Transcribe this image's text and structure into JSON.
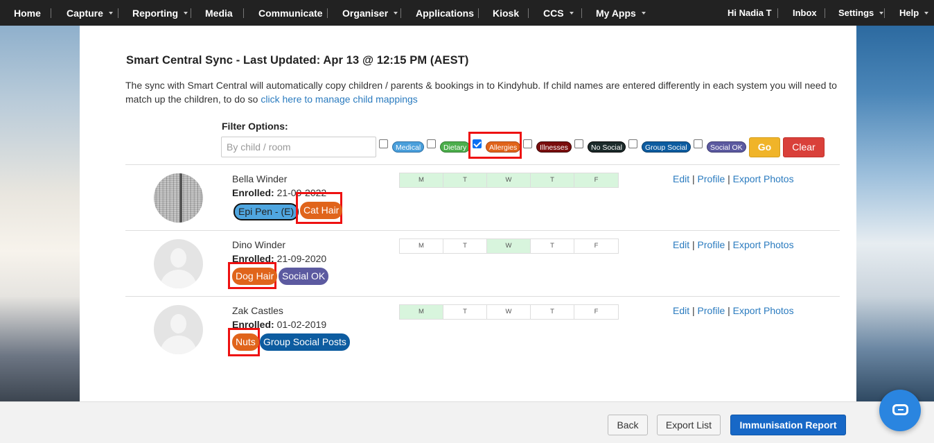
{
  "nav": {
    "items": [
      {
        "label": "Home",
        "caret": false
      },
      {
        "label": "Capture",
        "caret": true
      },
      {
        "label": "Reporting",
        "caret": true
      },
      {
        "label": "Media",
        "caret": false
      },
      {
        "label": "Communicate",
        "caret": false
      },
      {
        "label": "Organiser",
        "caret": true
      },
      {
        "label": "Applications",
        "caret": false
      },
      {
        "label": "Kiosk",
        "caret": false
      },
      {
        "label": "CCS",
        "caret": true
      },
      {
        "label": "My Apps",
        "caret": true
      }
    ],
    "right": [
      {
        "label": "Hi Nadia T",
        "caret": false
      },
      {
        "label": "Inbox",
        "caret": false
      },
      {
        "label": "Settings",
        "caret": true
      },
      {
        "label": "Help",
        "caret": true
      }
    ]
  },
  "page": {
    "title": "Smart Central Sync - Last Updated: Apr 13 @ 12:15 PM (AEST)",
    "intro": "The sync with Smart Central will automatically copy children / parents & bookings in to Kindyhub. If child names are entered differently in each system you will need to match up the children, to do so ",
    "intro_link": "click here to manage child mappings"
  },
  "filter": {
    "label": "Filter Options:",
    "placeholder": "By child / room",
    "value": "",
    "options": [
      {
        "label": "Medical",
        "color": "#4a9fdb",
        "checked": false
      },
      {
        "label": "Dietary",
        "color": "#4cae4c",
        "checked": false
      },
      {
        "label": "Allergies",
        "color": "#e0641b",
        "checked": true
      },
      {
        "label": "Illnesses",
        "color": "#7a0e0e",
        "checked": false
      },
      {
        "label": "No Social",
        "color": "#1c2b2b",
        "checked": false
      },
      {
        "label": "Group Social",
        "color": "#0d5ca0",
        "checked": false
      },
      {
        "label": "Social OK",
        "color": "#5c5aa0",
        "checked": false
      }
    ],
    "go_label": "Go",
    "clear_label": "Clear"
  },
  "days": [
    "M",
    "T",
    "W",
    "T",
    "F"
  ],
  "children": [
    {
      "name": "Bella Winder",
      "enrolled_label": "Enrolled:",
      "enrolled": "21-09-2022",
      "photo": true,
      "tags": [
        {
          "label": "Epi Pen - (E)",
          "color": "#4fa6e0",
          "text_color": "#222",
          "highlight": false
        },
        {
          "label": "Cat Hair",
          "color": "#e0641b",
          "text_color": "#fff",
          "highlight": true
        }
      ],
      "days_on": [
        true,
        true,
        true,
        true,
        true
      ],
      "actions": [
        "Edit",
        "Profile",
        "Export Photos"
      ]
    },
    {
      "name": "Dino Winder",
      "enrolled_label": "Enrolled:",
      "enrolled": "21-09-2020",
      "photo": false,
      "tags": [
        {
          "label": "Dog Hair",
          "color": "#e0641b",
          "text_color": "#fff",
          "highlight": true
        },
        {
          "label": "Social OK",
          "color": "#5c5aa0",
          "text_color": "#fff",
          "highlight": false
        }
      ],
      "days_on": [
        false,
        false,
        true,
        false,
        false
      ],
      "actions": [
        "Edit",
        "Profile",
        "Export Photos"
      ]
    },
    {
      "name": "Zak Castles",
      "enrolled_label": "Enrolled:",
      "enrolled": "01-02-2019",
      "photo": false,
      "tags": [
        {
          "label": "Nuts",
          "color": "#e0641b",
          "text_color": "#fff",
          "highlight": true
        },
        {
          "label": "Group Social Posts",
          "color": "#0d5ca0",
          "text_color": "#fff",
          "highlight": false
        }
      ],
      "days_on": [
        true,
        false,
        false,
        false,
        false
      ],
      "actions": [
        "Edit",
        "Profile",
        "Export Photos"
      ]
    }
  ],
  "footer": {
    "back_label": "Back",
    "export_label": "Export List",
    "immunisation_label": "Immunisation Report"
  },
  "chat": {
    "icon": "chat-icon"
  }
}
